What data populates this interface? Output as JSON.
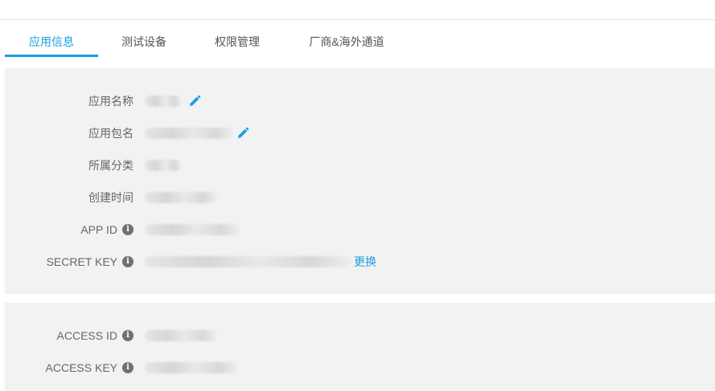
{
  "tabs": [
    {
      "label": "应用信息",
      "active": true
    },
    {
      "label": "测试设备",
      "active": false
    },
    {
      "label": "权限管理",
      "active": false
    },
    {
      "label": "厂商&海外通道",
      "active": false
    }
  ],
  "app_info": {
    "app_name": {
      "label": "应用名称",
      "value_masked": true
    },
    "package_name": {
      "label": "应用包名",
      "value_masked": true
    },
    "category": {
      "label": "所属分类",
      "value_masked": true
    },
    "created_time": {
      "label": "创建时间",
      "value_masked": true
    },
    "app_id": {
      "label": "APP ID",
      "value_masked": true
    },
    "secret_key": {
      "label": "SECRET KEY",
      "value_masked": true,
      "action_label": "更换"
    }
  },
  "access": {
    "access_id": {
      "label": "ACCESS ID",
      "value_masked": true
    },
    "access_key": {
      "label": "ACCESS KEY",
      "value_masked": true
    }
  },
  "icons": {
    "edit": "pencil-icon",
    "info": "info-icon"
  },
  "colors": {
    "accent": "#1a9de2",
    "panel_bg": "#f2f2f2",
    "info_icon": "#707070"
  }
}
